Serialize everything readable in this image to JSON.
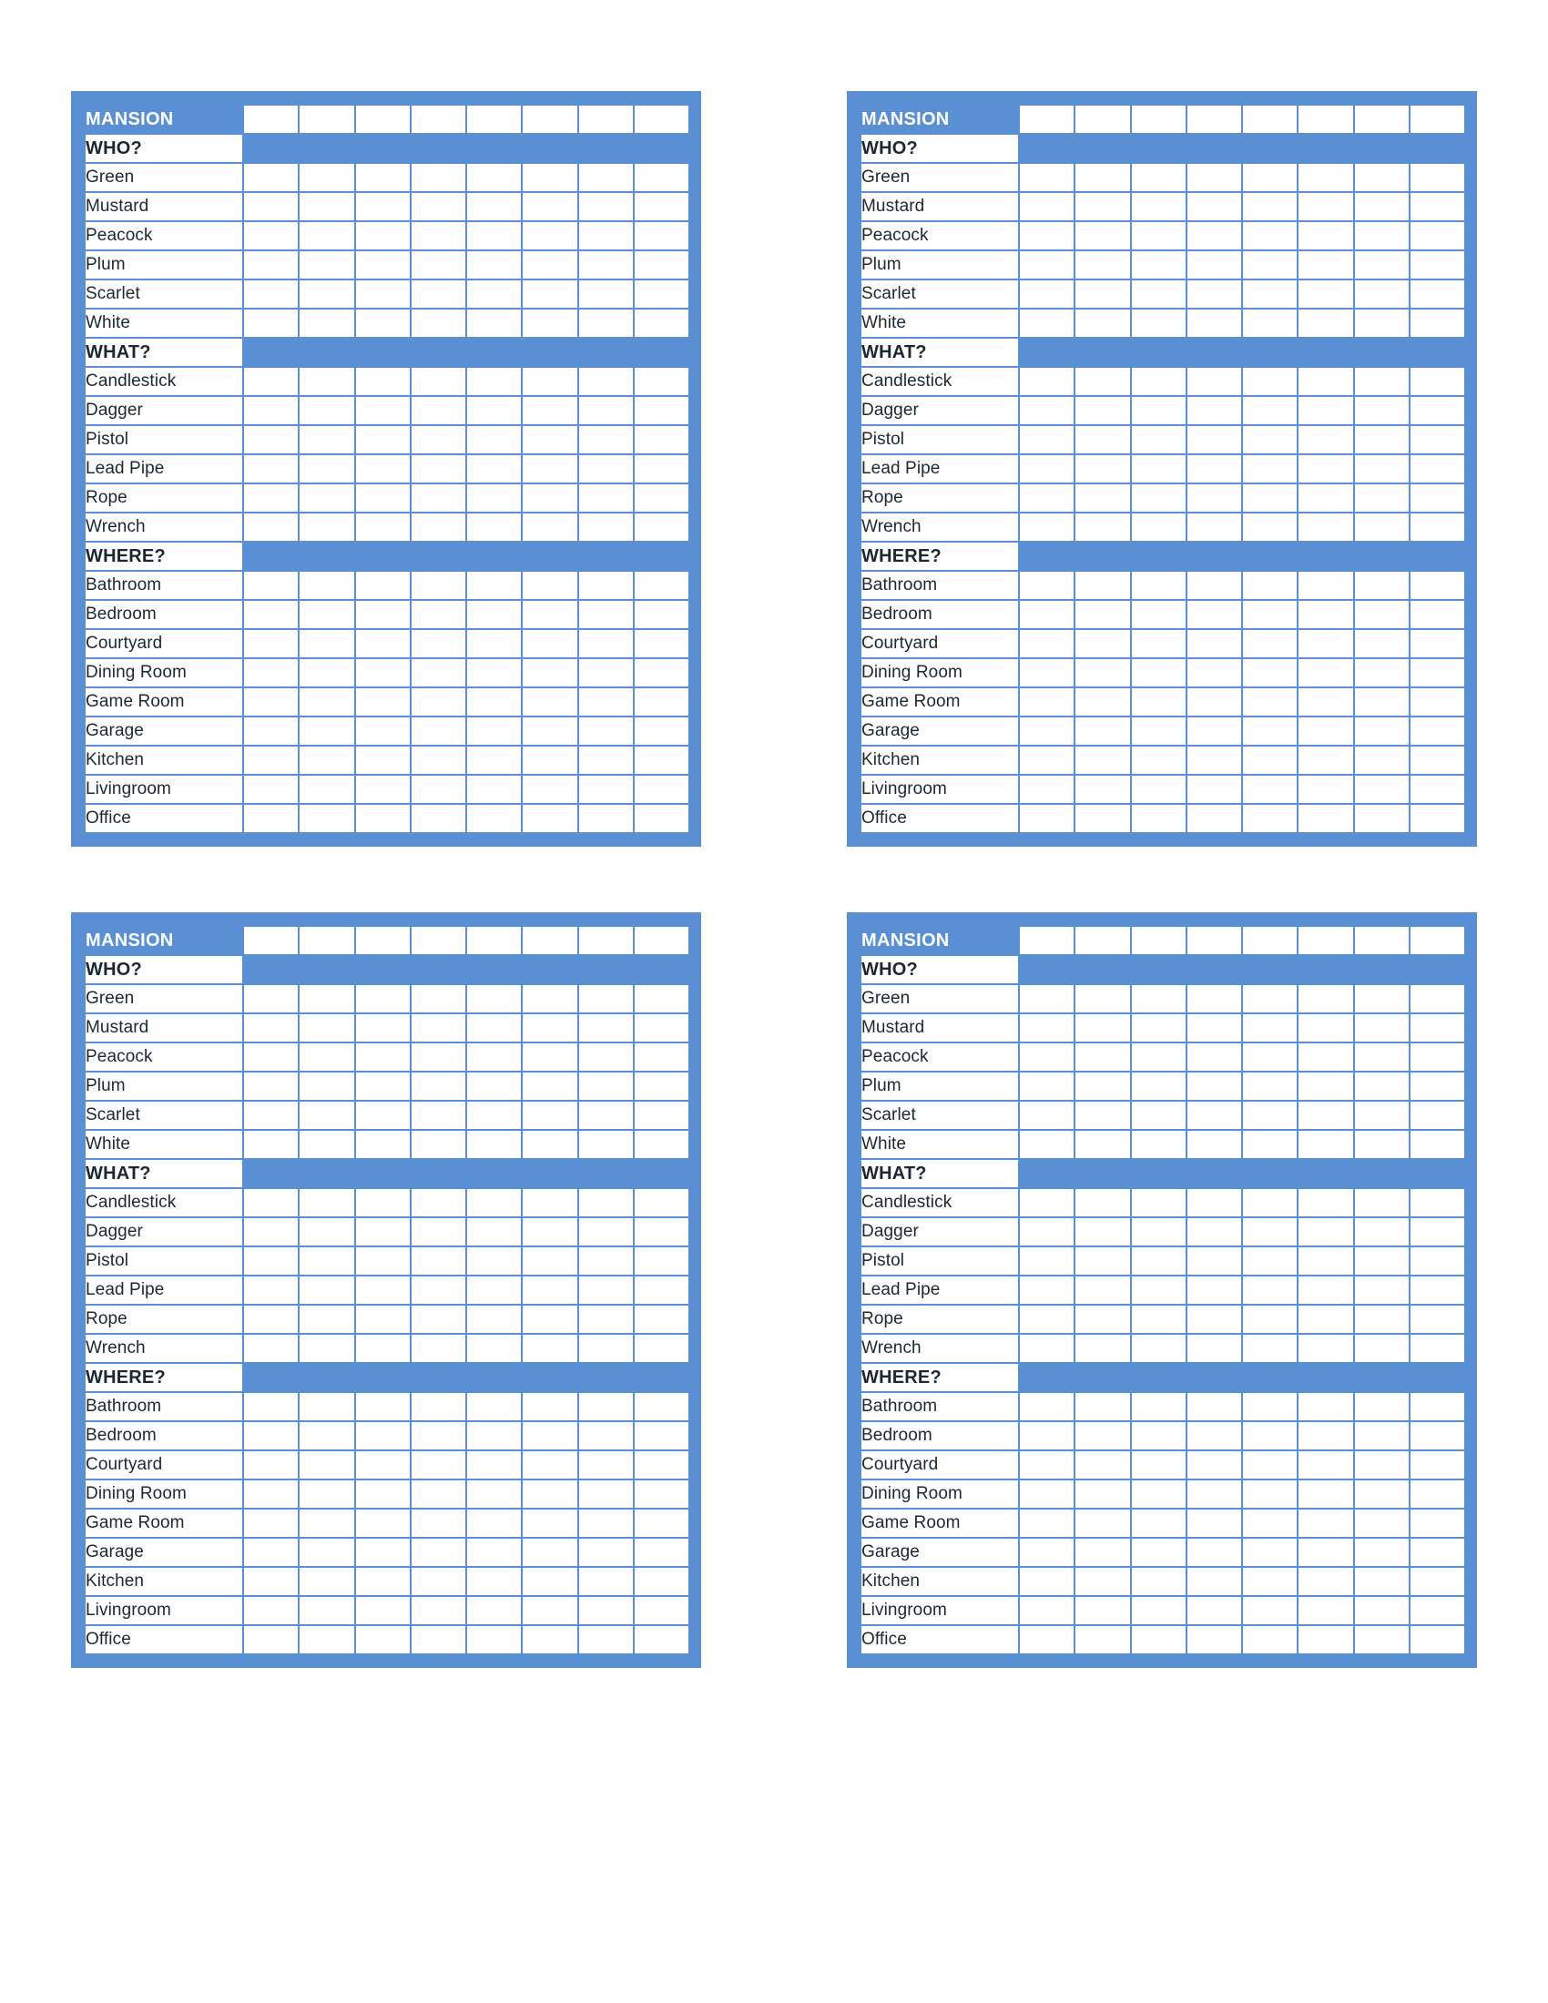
{
  "document": {
    "kind": "clue-detective-notes-worksheet",
    "sheet_count": 4,
    "layout": "2x2"
  },
  "colors": {
    "accent_blue": "#5B8FD4",
    "cell_white": "#FFFFFF",
    "text_dark": "#1D2733",
    "page_background": "#FFFFFF"
  },
  "sheet": {
    "title": "MANSION",
    "tally_columns": 8,
    "sections": [
      {
        "header": "WHO?",
        "items": [
          "Green",
          "Mustard",
          "Peacock",
          "Plum",
          "Scarlet",
          "White"
        ]
      },
      {
        "header": "WHAT?",
        "items": [
          "Candlestick",
          "Dagger",
          "Pistol",
          "Lead Pipe",
          "Rope",
          "Wrench"
        ]
      },
      {
        "header": "WHERE?",
        "items": [
          "Bathroom",
          "Bedroom",
          "Courtyard",
          "Dining Room",
          "Game Room",
          "Garage",
          "Kitchen",
          "Livingroom",
          "Office"
        ]
      }
    ]
  },
  "sheets": [
    {
      "id": "sheet-1",
      "position": "top-left"
    },
    {
      "id": "sheet-2",
      "position": "top-right"
    },
    {
      "id": "sheet-3",
      "position": "bottom-left"
    },
    {
      "id": "sheet-4",
      "position": "bottom-right"
    }
  ]
}
